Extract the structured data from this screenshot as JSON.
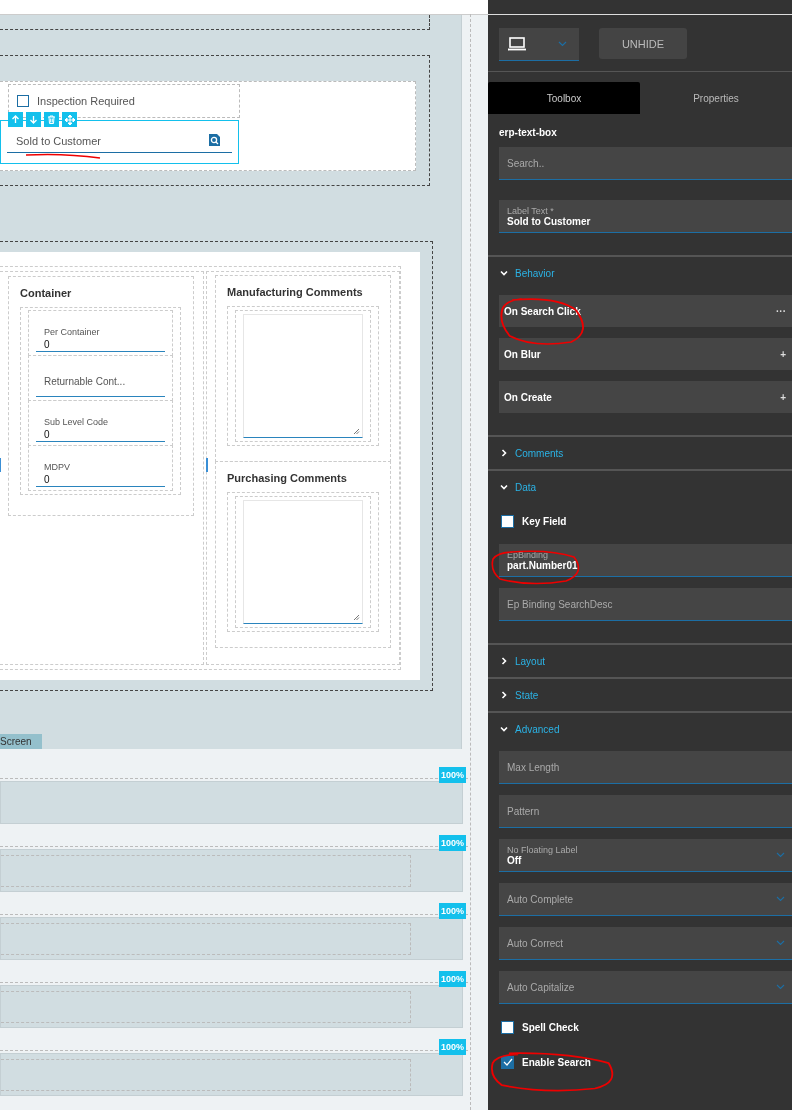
{
  "canvas": {
    "inspection": {
      "label": "Inspection Required",
      "checked": false
    },
    "selected_field": {
      "label": "Sold to Customer",
      "selected": true
    },
    "container": {
      "title": "Container",
      "fields": [
        {
          "label": "Per Container",
          "value": "0"
        },
        {
          "label": "Returnable Cont..."
        },
        {
          "label": "Sub Level Code",
          "value": "0"
        },
        {
          "label": "MDPV",
          "value": "0"
        }
      ]
    },
    "comments": [
      {
        "title": "Manufacturing Comments"
      },
      {
        "title": "Purchasing Comments"
      }
    ],
    "screen_tab": "Screen",
    "rows": [
      {
        "badge": "100%",
        "inner": false
      },
      {
        "badge": "100%",
        "inner": true
      },
      {
        "badge": "100%",
        "inner": true
      },
      {
        "badge": "100%",
        "inner": true
      },
      {
        "badge": "100%",
        "inner": true
      }
    ]
  },
  "panel": {
    "unhide": "UNHIDE",
    "tabs": [
      {
        "label": "Toolbox",
        "selected": true
      },
      {
        "label": "Properties",
        "selected": false
      }
    ],
    "component": "erp-text-box",
    "search": {
      "placeholder": "Search.."
    },
    "label_text": {
      "label": "Label Text *",
      "value": "Sold to Customer"
    },
    "sections": [
      {
        "title": "Behavior",
        "expanded": true,
        "items": [
          {
            "kind": "event",
            "label": "On Search Click",
            "action": "···"
          },
          {
            "kind": "event",
            "label": "On Blur",
            "action": "+"
          },
          {
            "kind": "event",
            "label": "On Create",
            "action": "+"
          }
        ]
      },
      {
        "title": "Comments",
        "expanded": false
      },
      {
        "title": "Data",
        "expanded": true,
        "items": [
          {
            "kind": "checkbox",
            "label": "Key Field",
            "checked": false
          },
          {
            "kind": "field",
            "label": "EpBinding",
            "value": "part.Number01"
          },
          {
            "kind": "field",
            "label": "Ep Binding SearchDesc"
          }
        ]
      },
      {
        "title": "Layout",
        "expanded": false
      },
      {
        "title": "State",
        "expanded": false
      },
      {
        "title": "Advanced",
        "expanded": true,
        "items": [
          {
            "kind": "field",
            "label": "Max Length"
          },
          {
            "kind": "field",
            "label": "Pattern"
          },
          {
            "kind": "select",
            "label": "No Floating Label",
            "value": "Off"
          },
          {
            "kind": "select",
            "label": "Auto Complete"
          },
          {
            "kind": "select",
            "label": "Auto Correct"
          },
          {
            "kind": "select",
            "label": "Auto Capitalize"
          },
          {
            "kind": "checkbox",
            "label": "Spell Check",
            "checked": false
          },
          {
            "kind": "checkbox",
            "label": "Enable Search",
            "checked": true
          }
        ]
      }
    ]
  }
}
